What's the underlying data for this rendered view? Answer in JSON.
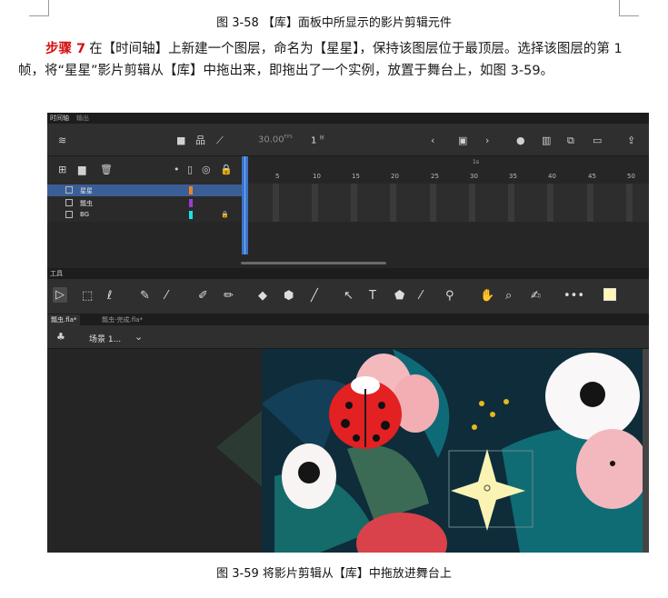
{
  "doc": {
    "caption_top": "图 3-58 【库】面板中所显示的影片剪辑元件",
    "step_label": "步骤 7",
    "paragraph": "在【时间轴】上新建一个图层，命名为【星星】，保持该图层位于最顶层。选择该图层的第 1 帧，将“星星”影片剪辑从【库】中拖出来，即拖出了一个实例，放置于舞台上，如图 3-59。",
    "caption_bottom": "图 3-59 将影片剪辑从【库】中拖放进舞台上"
  },
  "app": {
    "panel_tabs": [
      "时间轴",
      "输出"
    ],
    "timeline": {
      "fps": "30.00",
      "fps_unit": "FPS",
      "current_frame": "1",
      "frame_unit": "帧",
      "second_marker": "1s",
      "ruler_ticks": [
        "5",
        "10",
        "15",
        "20",
        "25",
        "30",
        "35",
        "40",
        "45",
        "50"
      ],
      "layers": [
        {
          "name": "星星",
          "color": "#f5821f",
          "selected": true,
          "locked": false
        },
        {
          "name": "瓢虫",
          "color": "#9b3bd1",
          "selected": false,
          "locked": false
        },
        {
          "name": "BG",
          "color": "#19e3e3",
          "selected": false,
          "locked": true
        }
      ]
    },
    "tools_title": "工具",
    "tools": [
      "selection-tool",
      "free-transform-tool",
      "lasso-tool",
      "paint-brush-tool",
      "brush-tool",
      "fluid-brush-tool",
      "pencil-tool",
      "eraser-tool",
      "polystar-tool",
      "line-tool",
      "subselection-tool",
      "text-tool",
      "paint-bucket-tool",
      "eyedropper-tool",
      "bone-tool",
      "hand-tool",
      "zoom-tool",
      "camera-tool",
      "more-tools"
    ],
    "doc_tabs": [
      {
        "label": "瓢虫.fla*",
        "active": true
      },
      {
        "label": "瓢虫-完成.fla*",
        "active": false
      }
    ],
    "scene_label": "场景 1...",
    "accent": "#3b75c9"
  }
}
